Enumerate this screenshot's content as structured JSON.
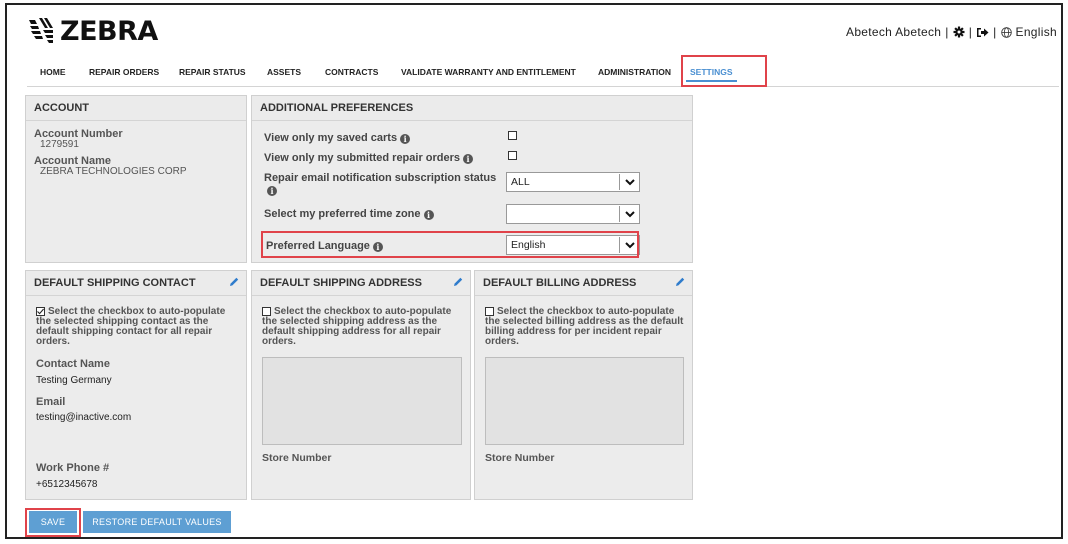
{
  "brand": {
    "name": "ZEBRA"
  },
  "userbar": {
    "user": "Abetech Abetech",
    "separator": "|",
    "language": "English"
  },
  "nav": {
    "items": [
      {
        "label": "HOME"
      },
      {
        "label": "REPAIR ORDERS"
      },
      {
        "label": "REPAIR STATUS"
      },
      {
        "label": "ASSETS"
      },
      {
        "label": "CONTRACTS"
      },
      {
        "label": "VALIDATE WARRANTY AND ENTITLEMENT"
      },
      {
        "label": "ADMINISTRATION"
      },
      {
        "label": "SETTINGS",
        "active": true
      }
    ]
  },
  "account": {
    "title": "ACCOUNT",
    "number_label": "Account Number",
    "number_value": "1279591",
    "name_label": "Account Name",
    "name_value": "ZEBRA TECHNOLOGIES CORP"
  },
  "preferences": {
    "title": "ADDITIONAL PREFERENCES",
    "saved_carts_label": "View only my saved carts",
    "submitted_orders_label": "View only my submitted repair orders",
    "email_status_label": "Repair email notification subscription status",
    "email_status_value": "ALL",
    "timezone_label": "Select my preferred time zone",
    "timezone_value": "",
    "language_label": "Preferred Language",
    "language_value": "English"
  },
  "shipping_contact": {
    "title": "DEFAULT SHIPPING CONTACT",
    "checkbox_text": "Select the checkbox to auto-populate the selected shipping contact as the default shipping contact for all repair orders.",
    "checked": true,
    "contact_name_label": "Contact Name",
    "contact_name_value": "Testing Germany",
    "email_label": "Email",
    "email_value": "testing@inactive.com",
    "phone_label": "Work Phone #",
    "phone_value": "+6512345678"
  },
  "shipping_address": {
    "title": "DEFAULT SHIPPING ADDRESS",
    "checkbox_text": "Select the checkbox to auto-populate the selected shipping address as the default shipping address for all repair orders.",
    "store_label": "Store Number"
  },
  "billing_address": {
    "title": "DEFAULT BILLING ADDRESS",
    "checkbox_text": "Select the checkbox to auto-populate the selected billing address as the default billing address for per incident repair orders.",
    "store_label": "Store Number"
  },
  "actions": {
    "save_label": "SAVE",
    "restore_label": "RESTORE DEFAULT VALUES"
  },
  "colors": {
    "accent": "#4a8fd1",
    "highlight": "#e0434a",
    "button": "#5e9fd3",
    "panel": "#ececec"
  },
  "icons": {
    "logo": "zebra-head-icon",
    "settings": "gear-icon",
    "logout": "sign-out-icon",
    "language": "globe-icon",
    "info": "info-icon",
    "edit": "pencil-icon",
    "dropdown": "chevron-down-icon"
  }
}
